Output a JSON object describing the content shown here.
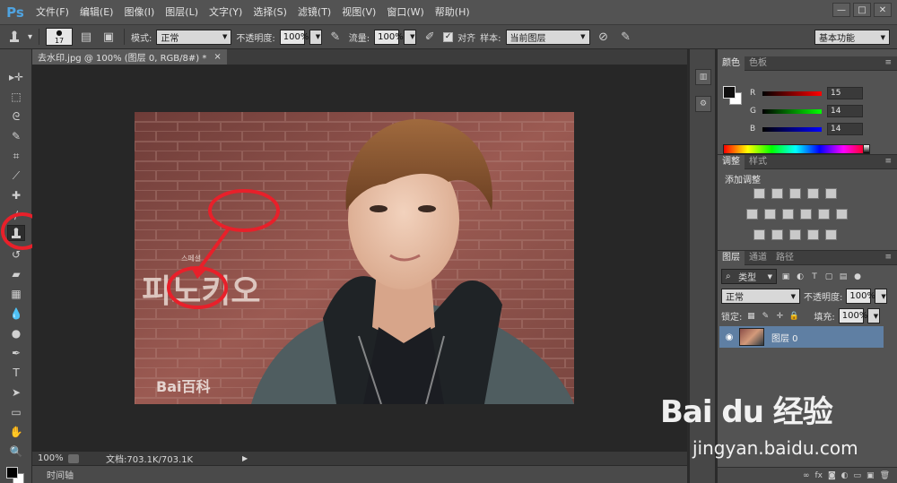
{
  "app": {
    "logo": "Ps"
  },
  "menu": [
    "文件(F)",
    "编辑(E)",
    "图像(I)",
    "图层(L)",
    "文字(Y)",
    "选择(S)",
    "滤镜(T)",
    "视图(V)",
    "窗口(W)",
    "帮助(H)"
  ],
  "window_controls": {
    "minimize": "—",
    "restore": "□",
    "close": "✕"
  },
  "options": {
    "brush_size": "17",
    "mode_label": "模式:",
    "mode_value": "正常",
    "opacity_label": "不透明度:",
    "opacity_value": "100%",
    "flow_label": "流量:",
    "flow_value": "100%",
    "aligned_label": "对齐",
    "sample_label": "样本:",
    "sample_value": "当前图层",
    "workspace": "基本功能"
  },
  "document": {
    "tab_title": "去水印.jpg @ 100% (图层 0, RGB/8#) *",
    "tab_close": "×",
    "image_text_korean": "피노키오",
    "image_text_small": "스페셜",
    "image_watermark": "Bai百科"
  },
  "status": {
    "zoom": "100%",
    "doc_info": "文档:703.1K/703.1K"
  },
  "timeline": {
    "label": "时间轴"
  },
  "color_panel": {
    "tabs": [
      "颜色",
      "色板"
    ],
    "r_label": "R",
    "r_value": "15",
    "g_label": "G",
    "g_value": "14",
    "b_label": "B",
    "b_value": "14",
    "foreground": "#0f0e0e",
    "background": "#ffffff"
  },
  "adjust_panel": {
    "tabs": [
      "调整",
      "样式"
    ],
    "title": "添加调整"
  },
  "layers_panel": {
    "tabs": [
      "图层",
      "通道",
      "路径"
    ],
    "kind_filter": "类型",
    "blend_mode": "正常",
    "opacity_label": "不透明度:",
    "opacity_value": "100%",
    "lock_label": "锁定:",
    "fill_label": "填充:",
    "fill_value": "100%",
    "layer_name": "图层 0"
  },
  "watermark": {
    "logo": "Bai du 经验",
    "url": "jingyan.baidu.com"
  },
  "colors": {
    "annotation": "#e8202a",
    "accent": "#5f7fa3"
  }
}
